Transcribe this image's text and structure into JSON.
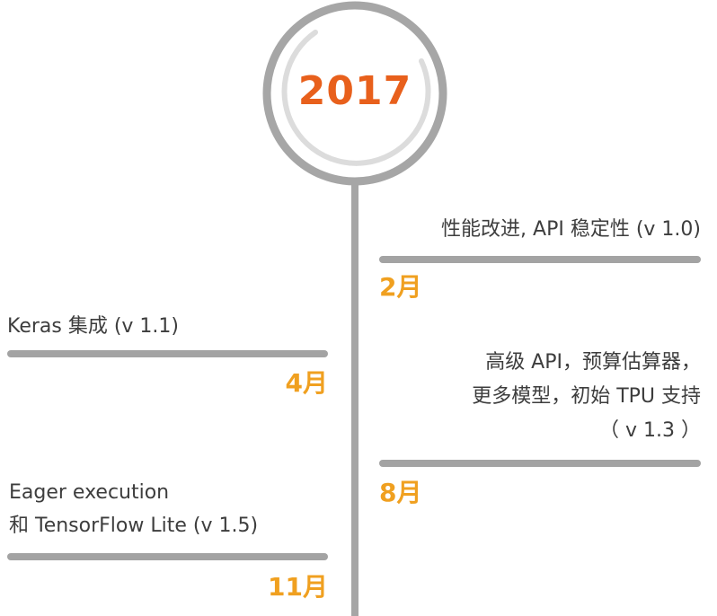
{
  "year": "2017",
  "colors": {
    "year_accent": "#e8601c",
    "month_accent": "#f0a020",
    "line_gray": "#a6a6a6",
    "text": "#3d3d3d"
  },
  "events": [
    {
      "id": "feb",
      "side": "right",
      "lines": [
        "性能改进, API 稳定性 (v 1.0)"
      ],
      "month": "2月"
    },
    {
      "id": "apr",
      "side": "left",
      "lines": [
        "Keras 集成 (v 1.1)"
      ],
      "month": "4月"
    },
    {
      "id": "aug",
      "side": "right",
      "lines": [
        "高级 API，预算估算器，",
        "更多模型，初始 TPU 支持",
        "（ v 1.3 ）"
      ],
      "month": "8月"
    },
    {
      "id": "nov",
      "side": "left",
      "lines": [
        "Eager execution",
        "和 TensorFlow Lite (v 1.5)"
      ],
      "month": "11月"
    }
  ]
}
